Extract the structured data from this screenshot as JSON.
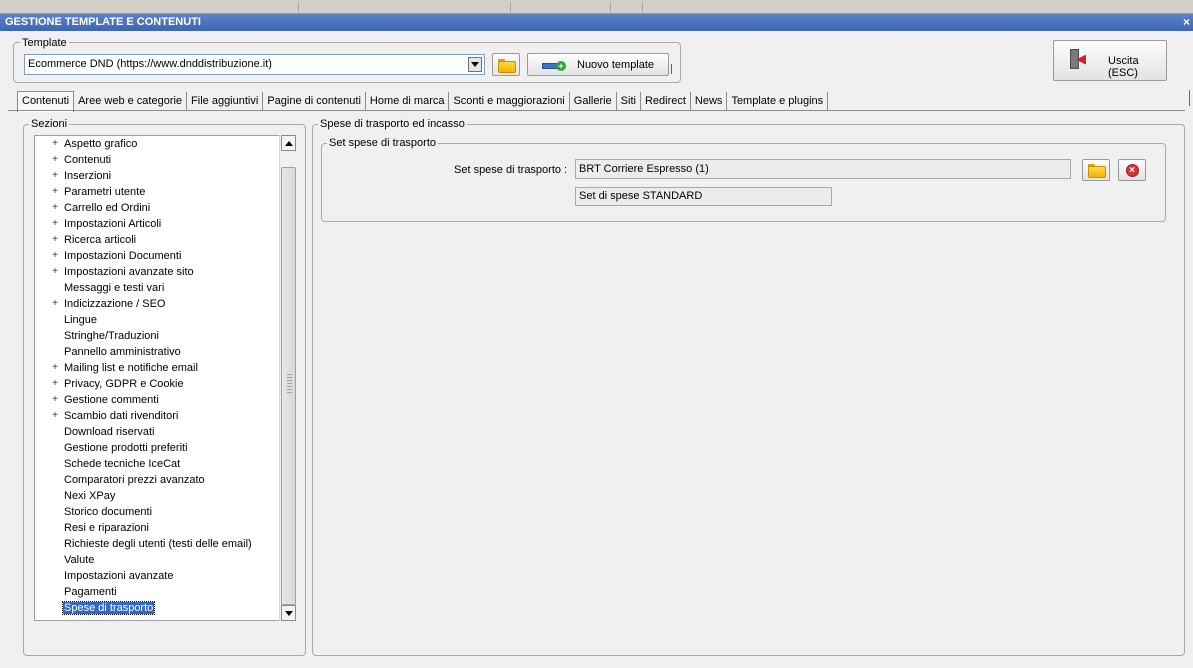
{
  "window": {
    "title": "GESTIONE TEMPLATE E CONTENUTI",
    "close_glyph": "×"
  },
  "template_group": {
    "legend": "Template",
    "selected": "Ecommerce DND (https://www.dnddistribuzione.it)",
    "browse_icon": "folder-icon",
    "new_template_label": "Nuovo template"
  },
  "exit_button": {
    "label": "Uscita (ESC)",
    "icon": "exit-door-icon"
  },
  "tabs": [
    {
      "label": "Contenuti",
      "active": true
    },
    {
      "label": "Aree web e categorie"
    },
    {
      "label": "File aggiuntivi"
    },
    {
      "label": "Pagine di contenuti"
    },
    {
      "label": "Home di marca"
    },
    {
      "label": "Sconti e maggiorazioni"
    },
    {
      "label": "Gallerie"
    },
    {
      "label": "Siti"
    },
    {
      "label": "Redirect"
    },
    {
      "label": "News"
    },
    {
      "label": "Template e plugins"
    }
  ],
  "sections": {
    "legend": "Sezioni",
    "items": [
      {
        "label": "Aspetto grafico",
        "expandable": true
      },
      {
        "label": "Contenuti",
        "expandable": true
      },
      {
        "label": "Inserzioni",
        "expandable": true
      },
      {
        "label": "Parametri utente",
        "expandable": true
      },
      {
        "label": "Carrello ed Ordini",
        "expandable": true
      },
      {
        "label": "Impostazioni Articoli",
        "expandable": true
      },
      {
        "label": "Ricerca articoli",
        "expandable": true
      },
      {
        "label": "Impostazioni Documenti",
        "expandable": true
      },
      {
        "label": "Impostazioni avanzate sito",
        "expandable": true
      },
      {
        "label": "Messaggi e testi vari",
        "expandable": false
      },
      {
        "label": "Indicizzazione / SEO",
        "expandable": true
      },
      {
        "label": "Lingue",
        "expandable": false
      },
      {
        "label": "Stringhe/Traduzioni",
        "expandable": false
      },
      {
        "label": "Pannello amministrativo",
        "expandable": false
      },
      {
        "label": "Mailing list e notifiche email",
        "expandable": true
      },
      {
        "label": "Privacy, GDPR e Cookie",
        "expandable": true
      },
      {
        "label": "Gestione commenti",
        "expandable": true
      },
      {
        "label": "Scambio dati rivenditori",
        "expandable": true
      },
      {
        "label": "Download riservati",
        "expandable": false
      },
      {
        "label": "Gestione prodotti preferiti",
        "expandable": false
      },
      {
        "label": "Schede tecniche IceCat",
        "expandable": false
      },
      {
        "label": "Comparatori prezzi avanzato",
        "expandable": false
      },
      {
        "label": "Nexi XPay",
        "expandable": false
      },
      {
        "label": "Storico documenti",
        "expandable": false
      },
      {
        "label": "Resi e riparazioni",
        "expandable": false
      },
      {
        "label": "Richieste degli utenti (testi delle email)",
        "expandable": false
      },
      {
        "label": "Valute",
        "expandable": false
      },
      {
        "label": "Impostazioni avanzate",
        "expandable": false
      },
      {
        "label": "Pagamenti",
        "expandable": false
      },
      {
        "label": "Spese di trasporto",
        "expandable": false,
        "selected": true
      }
    ]
  },
  "detail": {
    "legend": "Spese di trasporto ed incasso",
    "group_legend": "Set spese di trasporto",
    "field_label": "Set spese di trasporto :",
    "field_value": "BRT Corriere Espresso (1)",
    "field_subvalue": "Set di spese STANDARD",
    "browse_icon": "folder-icon",
    "delete_icon": "delete-icon"
  },
  "colors": {
    "titlebar": "#3d66b3",
    "selection": "#3169c6"
  }
}
